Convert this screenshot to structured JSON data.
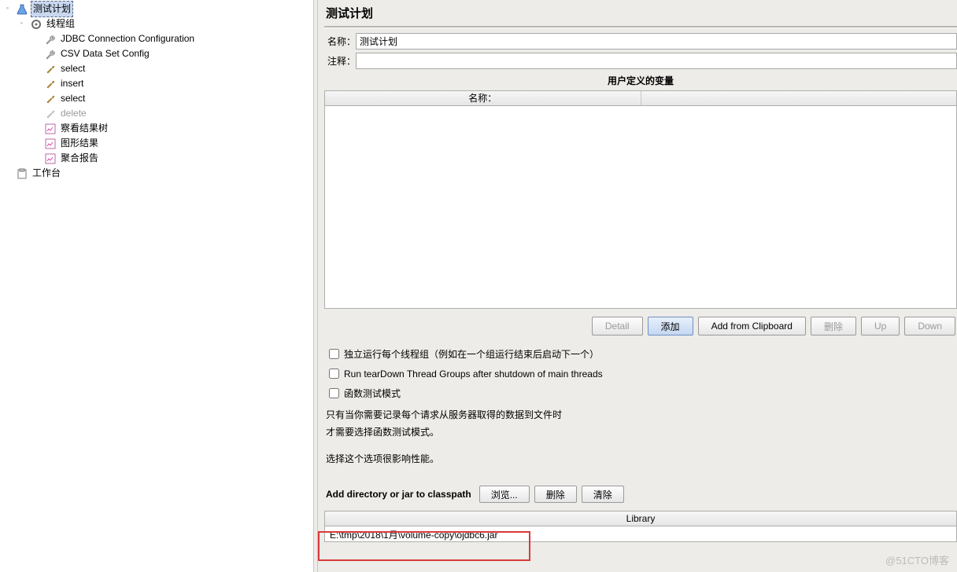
{
  "tree": {
    "root_label": "测试计划",
    "thread_group": "线程组",
    "items": [
      "JDBC Connection Configuration",
      "CSV Data Set Config",
      "select",
      "insert",
      "select",
      "delete",
      "察看结果树",
      "图形结果",
      "聚合报告"
    ],
    "workbench": "工作台"
  },
  "panel": {
    "title": "测试计划",
    "name_label": "名称：",
    "name_value": "测试计划",
    "comment_label": "注释：",
    "comment_value": "",
    "vars_section": "用户定义的变量",
    "col_name": "名称：",
    "btn_detail": "Detail",
    "btn_add": "添加",
    "btn_add_clip": "Add from Clipboard",
    "btn_delete": "删除",
    "btn_up": "Up",
    "btn_down": "Down",
    "chk_serial": "独立运行每个线程组（例如在一个组运行结束后启动下一个）",
    "chk_teardown": "Run tearDown Thread Groups after shutdown of main threads",
    "chk_func": "函数测试模式",
    "note1": "只有当你需要记录每个请求从服务器取得的数据到文件时",
    "note2": "才需要选择函数测试模式。",
    "note3": "选择这个选项很影响性能。",
    "classpath_label": "Add directory or jar to classpath",
    "btn_browse": "浏览...",
    "btn_del2": "删除",
    "btn_clear": "清除",
    "lib_header": "Library",
    "lib_value": "E:\\tmp\\2018\\1月\\volume-copy\\ojdbc6.jar"
  },
  "watermark": "@51CTO博客"
}
